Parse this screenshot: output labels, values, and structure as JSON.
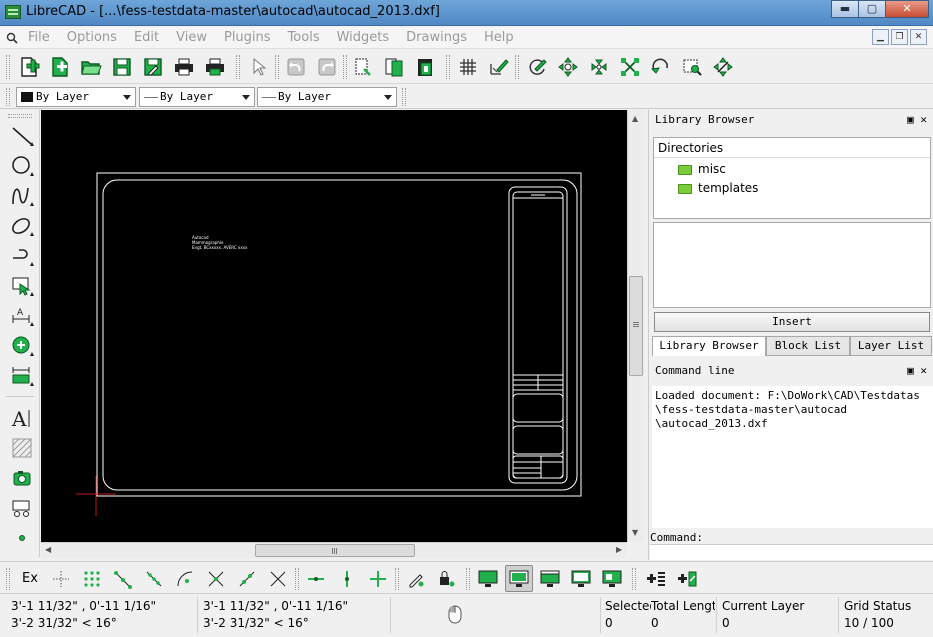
{
  "window": {
    "title": "LibreCAD - [...\\fess-testdata-master\\autocad\\autocad_2013.dxf]",
    "minimize": "▬",
    "maximize": "▢",
    "close": "✕"
  },
  "menu": {
    "items": [
      "File",
      "Options",
      "Edit",
      "View",
      "Plugins",
      "Tools",
      "Widgets",
      "Drawings",
      "Help"
    ]
  },
  "pen_toolbar": {
    "color": "By Layer",
    "line_type": "By Layer",
    "line_width": "By Layer"
  },
  "canvas": {
    "background": "#000000",
    "drawing_text_lines": [
      "Autocad",
      "Mammographie",
      "Engt. BCxxxxx. AVERC xxxx"
    ]
  },
  "library_browser": {
    "title": "Library Browser",
    "directories_header": "Directories",
    "directories": [
      "misc",
      "templates"
    ],
    "insert_label": "Insert",
    "tabs": [
      "Library Browser",
      "Block List",
      "Layer List"
    ],
    "active_tab": "Library Browser"
  },
  "command_line": {
    "title": "Command line",
    "output": "Loaded document: F:\\DoWork\\CAD\\Testdatas\n\\fess-testdata-master\\autocad\n\\autocad_2013.dxf",
    "prompt_label": "Command:",
    "input_value": ""
  },
  "snap_toolbar": {
    "exclusive_label": "Ex"
  },
  "status": {
    "abs_coord_1": "3'-1 11/32\" , 0'-11 1/16\"",
    "abs_coord_2": "3'-2 31/32\" < 16°",
    "rel_coord_1": "3'-1 11/32\" , 0'-11 1/16\"",
    "rel_coord_2": "3'-2 31/32\" < 16°",
    "selected_label": "Selected",
    "selected_value": "0",
    "total_length_label": "Total Length",
    "total_length_value": "0",
    "current_layer_label": "Current Layer",
    "current_layer_value": "0",
    "grid_status_label": "Grid Status",
    "grid_status_value": "10 / 100"
  },
  "colors": {
    "accent_green": "#21b04b",
    "canvas_bg": "#000000",
    "crosshair": "#c01818"
  }
}
